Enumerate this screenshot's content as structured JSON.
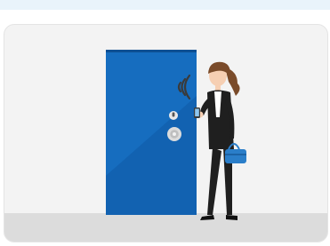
{
  "illustration": {
    "subject": "woman-unlocking-door-with-phone",
    "colors": {
      "top_strip": "#e9f3fb",
      "card_background": "#f3f3f3",
      "floor": "#dcdcdc",
      "door": "#1467b8",
      "door_shade": "#0f5aa3",
      "suit": "#1f1f1f",
      "shirt": "#ffffff",
      "hair": "#7a4b2a",
      "skin": "#f6cfb3",
      "bag": "#2a7ec9",
      "nfc_waves": "#3a3a3a"
    },
    "icons": [
      "nfc-signal-icon",
      "door-lock-icon",
      "door-handle-icon"
    ]
  }
}
